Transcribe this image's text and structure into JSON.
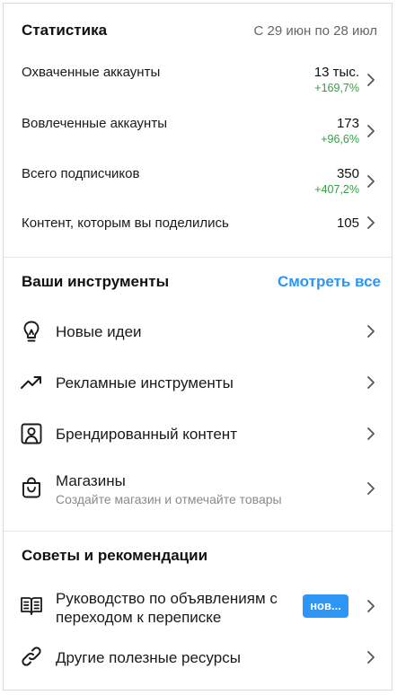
{
  "stats": {
    "title": "Статистика",
    "range": "С 29 июн по 28 июл",
    "items": [
      {
        "label": "Охваченные аккаунты",
        "value": "13 тыс.",
        "delta": "+169,7%"
      },
      {
        "label": "Вовлеченные аккаунты",
        "value": "173",
        "delta": "+96,6%"
      },
      {
        "label": "Всего подписчиков",
        "value": "350",
        "delta": "+407,2%"
      },
      {
        "label": "Контент, которым вы поделились",
        "value": "105",
        "delta": ""
      }
    ]
  },
  "tools": {
    "title": "Ваши инструменты",
    "see_all": "Смотреть все",
    "items": [
      {
        "label": "Новые идеи",
        "icon": "lightbulb-icon"
      },
      {
        "label": "Рекламные инструменты",
        "icon": "trending-up-icon"
      },
      {
        "label": "Брендированный контент",
        "icon": "branded-content-icon"
      },
      {
        "label": "Магазины",
        "sublabel": "Создайте магазин и отмечайте товары",
        "icon": "shopping-bag-icon"
      }
    ]
  },
  "tips": {
    "title": "Советы и рекомендации",
    "items": [
      {
        "label_line1": "Руководство по объявлениям с",
        "label_line2": "переходом к переписке",
        "badge": "нов...",
        "icon": "book-icon"
      },
      {
        "label": "Другие полезные ресурсы",
        "icon": "link-icon"
      }
    ]
  },
  "colors": {
    "accent": "#2c95f6",
    "positive": "#3a9a46",
    "muted": "#8a8a8a"
  }
}
